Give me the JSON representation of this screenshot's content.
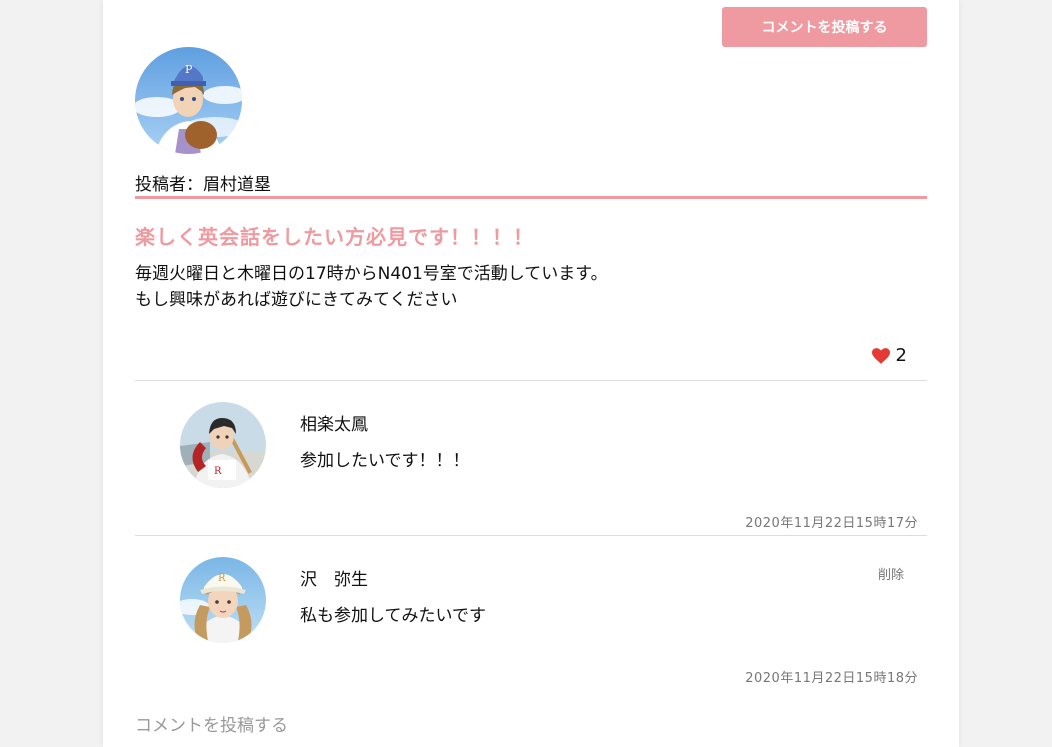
{
  "actions": {
    "post_comment_label": "コメントを投稿する"
  },
  "post": {
    "author_label": "投稿者：眉村道塁",
    "title": "楽しく英会話をしたい方必見です！！！！",
    "body_lines": [
      "毎週火曜日と木曜日の17時からN401号室で活動しています。",
      "もし興味があれば遊びにきてみてください"
    ],
    "like_count": "2",
    "accent_color": "#ee9aa0",
    "heart_color": "#e53935"
  },
  "comments": [
    {
      "name": "相楽太鳳",
      "text": "参加したいです！！！",
      "timestamp": "2020年11月22日15時17分"
    },
    {
      "name": "沢　弥生",
      "text": "私も参加してみたいです",
      "timestamp": "2020年11月22日15時18分",
      "delete_label": "削除"
    }
  ],
  "comment_form": {
    "placeholder": "コメントを投稿する"
  },
  "icons": {
    "like": "heart-icon"
  }
}
